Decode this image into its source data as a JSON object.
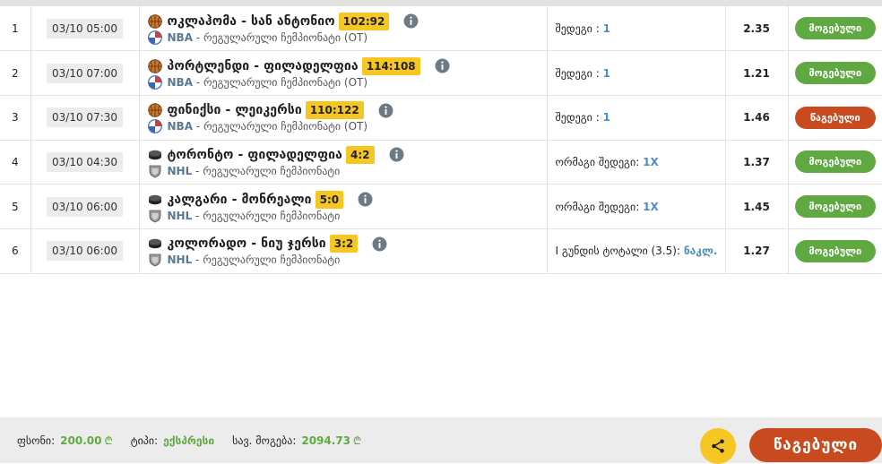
{
  "colors": {
    "win": "#5fa842",
    "lose": "#c94a1e",
    "score_bg": "#f6c623",
    "league": "#5a7896",
    "bet_value": "#4d8ec0"
  },
  "rows": [
    {
      "num": "1",
      "time": "03/10 05:00",
      "sport_icon": "basketball-icon",
      "teams": "ოკლაჰომა - სან ანტონიო",
      "score": "102:92",
      "league_icon": "nba-logo-icon",
      "league_short": "NBA",
      "league_rest": " - რეგულარული ჩემპიონატი (OT)",
      "bet_label": "შედეგი : ",
      "bet_value": "1",
      "odd": "2.35",
      "status": "მოგებული",
      "status_type": "win"
    },
    {
      "num": "2",
      "time": "03/10 07:00",
      "sport_icon": "basketball-icon",
      "teams": "პორტლენდი - ფილადელფია",
      "score": "114:108",
      "league_icon": "nba-logo-icon",
      "league_short": "NBA",
      "league_rest": " - რეგულარული ჩემპიონატი (OT)",
      "bet_label": "შედეგი : ",
      "bet_value": "1",
      "odd": "1.21",
      "status": "მოგებული",
      "status_type": "win"
    },
    {
      "num": "3",
      "time": "03/10 07:30",
      "sport_icon": "basketball-icon",
      "teams": "ფინიქსი - ლეიკერსი",
      "score": "110:122",
      "league_icon": "nba-logo-icon",
      "league_short": "NBA",
      "league_rest": " - რეგულარული ჩემპიონატი (OT)",
      "bet_label": "შედეგი : ",
      "bet_value": "1",
      "odd": "1.46",
      "status": "წაგებული",
      "status_type": "lose"
    },
    {
      "num": "4",
      "time": "03/10 04:30",
      "sport_icon": "hockey-puck-icon",
      "teams": "ტორონტო - ფილადელფია",
      "score": "4:2",
      "league_icon": "nhl-logo-icon",
      "league_short": "NHL",
      "league_rest": " - რეგულარული ჩემპიონატი",
      "bet_label": "ორმაგი შედეგი: ",
      "bet_value": "1X",
      "odd": "1.37",
      "status": "მოგებული",
      "status_type": "win"
    },
    {
      "num": "5",
      "time": "03/10 06:00",
      "sport_icon": "hockey-puck-icon",
      "teams": "კალგარი - მონრეალი",
      "score": "5:0",
      "league_icon": "nhl-logo-icon",
      "league_short": "NHL",
      "league_rest": " - რეგულარული ჩემპიონატი",
      "bet_label": "ორმაგი შედეგი: ",
      "bet_value": "1X",
      "odd": "1.45",
      "status": "მოგებული",
      "status_type": "win"
    },
    {
      "num": "6",
      "time": "03/10 06:00",
      "sport_icon": "hockey-puck-icon",
      "teams": "კოლორადო - ნიუ ჯერსი",
      "score": "3:2",
      "league_icon": "nhl-logo-icon",
      "league_short": "NHL",
      "league_rest": " - რეგულარული ჩემპიონატი",
      "bet_label": "I გუნდის ტოტალი (3.5): ",
      "bet_value": "ნაკლ.",
      "odd": "1.27",
      "status": "მოგებული",
      "status_type": "win"
    }
  ],
  "footer": {
    "stake_label": "ფსონი:",
    "stake_value": "200.00",
    "currency": "₾",
    "type_label": "ტიპი:",
    "type_value": "ექსპრესი",
    "win_label": "სავ. მოგება:",
    "win_value": "2094.73",
    "share_icon": "share-icon",
    "final_status": "წაგებული"
  }
}
